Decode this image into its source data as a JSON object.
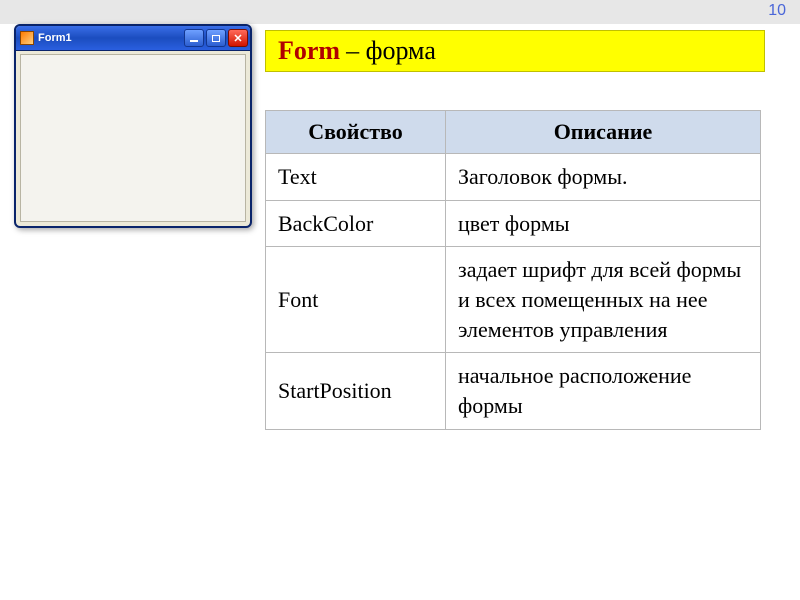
{
  "page_number": "10",
  "heading": {
    "strong": "Form",
    "rest": " – форма"
  },
  "window": {
    "title": "Form1",
    "buttons": {
      "minimize": "minimize",
      "maximize": "maximize",
      "close": "close"
    }
  },
  "table": {
    "headers": {
      "property": "Свойство",
      "description": "Описание"
    },
    "rows": [
      {
        "property": "Text",
        "description": "Заголовок формы."
      },
      {
        "property": "BackColor",
        "description": " цвет формы"
      },
      {
        "property": "Font",
        "description": "задает шрифт для всей формы и всех помещенных на нее элементов управления"
      },
      {
        "property": "StartPosition",
        "description": "начальное расположение формы"
      }
    ]
  }
}
